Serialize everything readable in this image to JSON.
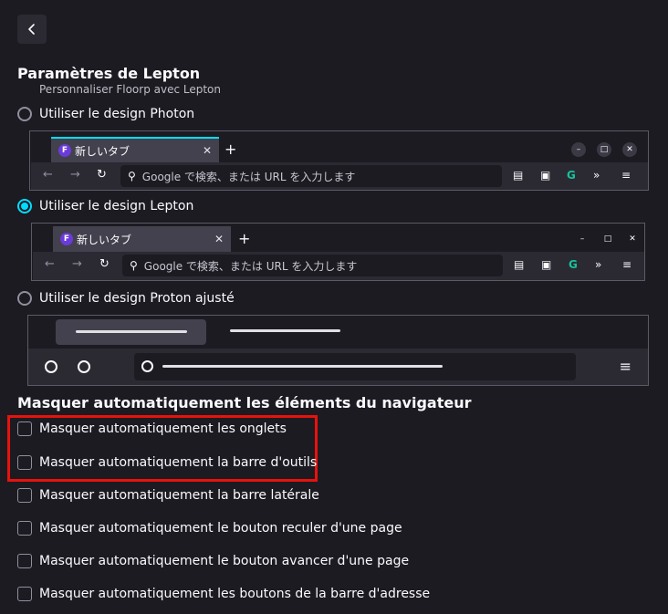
{
  "header": {
    "title": "Paramètres de Lepton",
    "subtitle": "Personnaliser Floorp avec Lepton"
  },
  "design_options": [
    {
      "label": "Utiliser le design Photon",
      "checked": false
    },
    {
      "label": "Utiliser le design Lepton",
      "checked": true
    },
    {
      "label": "Utiliser le design Proton ajusté",
      "checked": false
    }
  ],
  "preview": {
    "tab_title": "新しいタブ",
    "url_placeholder": "Google で検索、または URL を入力します",
    "new_tab_symbol": "+",
    "close_symbol": "✕",
    "tab_icon_letter": "F",
    "toolbar_g": "G",
    "menu_symbol": "≡"
  },
  "autohide": {
    "section_title": "Masquer automatiquement les éléments du navigateur",
    "items": [
      {
        "label": "Masquer automatiquement les onglets",
        "checked": false
      },
      {
        "label": "Masquer automatiquement la barre d'outils",
        "checked": false
      },
      {
        "label": "Masquer automatiquement la barre latérale",
        "checked": false
      },
      {
        "label": "Masquer automatiquement le bouton reculer d'une page",
        "checked": false
      },
      {
        "label": "Masquer automatiquement le bouton avancer d'une page",
        "checked": false
      },
      {
        "label": "Masquer automatiquement les boutons de la barre d'adresse",
        "checked": false
      }
    ]
  },
  "colors": {
    "background": "#1c1b22",
    "accent": "#00ddff",
    "highlight": "#e8120c"
  }
}
